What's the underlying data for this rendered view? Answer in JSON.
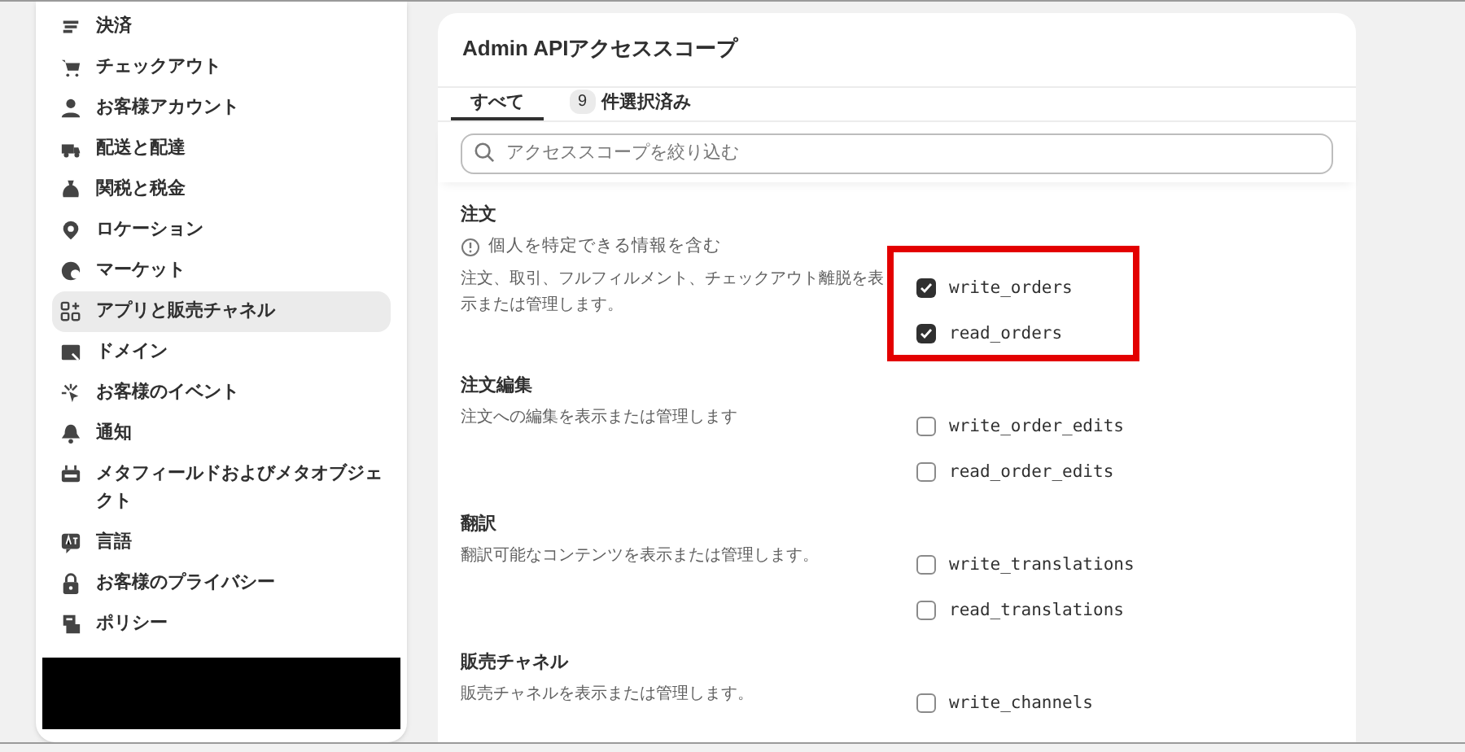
{
  "sidebar": {
    "items": [
      {
        "label": "決済",
        "selected": false
      },
      {
        "label": "チェックアウト",
        "selected": false
      },
      {
        "label": "お客様アカウント",
        "selected": false
      },
      {
        "label": "配送と配達",
        "selected": false
      },
      {
        "label": "関税と税金",
        "selected": false
      },
      {
        "label": "ロケーション",
        "selected": false
      },
      {
        "label": "マーケット",
        "selected": false
      },
      {
        "label": "アプリと販売チャネル",
        "selected": true
      },
      {
        "label": "ドメイン",
        "selected": false
      },
      {
        "label": "お客様のイベント",
        "selected": false
      },
      {
        "label": "通知",
        "selected": false
      },
      {
        "label": "メタフィールドおよびメタオブジェクト",
        "selected": false
      },
      {
        "label": "言語",
        "selected": false
      },
      {
        "label": "お客様のプライバシー",
        "selected": false
      },
      {
        "label": "ポリシー",
        "selected": false
      }
    ]
  },
  "card": {
    "title": "Admin APIアクセススコープ",
    "tabs": [
      {
        "label": "すべて",
        "selected": true
      },
      {
        "count": "9",
        "label": "件選択済み",
        "selected": false
      }
    ],
    "search": {
      "placeholder": "アクセススコープを絞り込む"
    },
    "sections": [
      {
        "title": "注文",
        "note": "個人を特定できる情報を含む",
        "description": "注文、取引、フルフィルメント、チェックアウト離脱を表示または管理します。",
        "highlighted": true,
        "scopes": [
          {
            "name": "write_orders",
            "checked": true
          },
          {
            "name": "read_orders",
            "checked": true
          }
        ]
      },
      {
        "title": "注文編集",
        "description": "注文への編集を表示または管理します",
        "highlighted": false,
        "scopes": [
          {
            "name": "write_order_edits",
            "checked": false
          },
          {
            "name": "read_order_edits",
            "checked": false
          }
        ]
      },
      {
        "title": "翻訳",
        "description": "翻訳可能なコンテンツを表示または管理します。",
        "highlighted": false,
        "scopes": [
          {
            "name": "write_translations",
            "checked": false
          },
          {
            "name": "read_translations",
            "checked": false
          }
        ]
      },
      {
        "title": "販売チャネル",
        "description": "販売チャネルを表示または管理します。",
        "highlighted": false,
        "scopes": [
          {
            "name": "write_channels",
            "checked": false
          }
        ]
      }
    ]
  }
}
